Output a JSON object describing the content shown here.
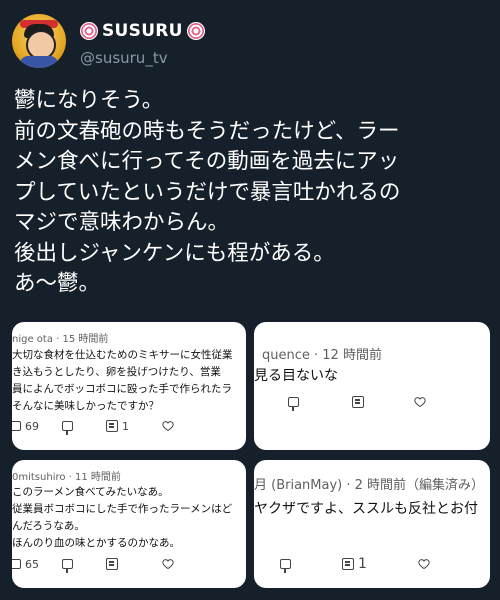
{
  "profile": {
    "display_name": "SUSURU",
    "handle": "@susuru_tv"
  },
  "tweet": {
    "lines": [
      "鬱になりそう。",
      "前の文春砲の時もそうだったけど、ラー",
      "メン食べに行ってその動画を過去にアッ",
      "プしていたというだけで暴言吐かれるの",
      "マジで意味わからん。",
      "後出しジャンケンにも程がある。",
      "あ〜鬱。"
    ]
  },
  "comments": [
    {
      "meta": "nige ota · 15 時間前",
      "lines": [
        "大切な食材を仕込むためのミキサーに女性従業",
        "き込もうとしたり、卵を投げつけたり、営業",
        "員によんでボッコボコに殴った手で作られたラ",
        "そんなに美味しかったですか？"
      ],
      "likes": "69",
      "replies": "1"
    },
    {
      "meta": "quence · 12 時間前",
      "lines": [
        "見る目ないな"
      ],
      "likes": "",
      "replies": ""
    },
    {
      "meta": "0mitsuhiro · 11 時間前",
      "lines": [
        "このラーメン食べてみたいなあ。",
        "従業員ボコボコにした手で作ったラーメンはど",
        "んだろうなあ。",
        "ほんのり血の味とかするのかなあ。"
      ],
      "likes": "65",
      "replies": ""
    },
    {
      "meta": "月 (BrianMay) · 2 時間前（編集済み）",
      "lines": [
        "ヤクザですよ、ススルも反社とお付"
      ],
      "likes": "",
      "replies": "1"
    }
  ],
  "colors": {
    "background": "#15202b",
    "handle": "#8899a6",
    "card": "#ffffff"
  }
}
